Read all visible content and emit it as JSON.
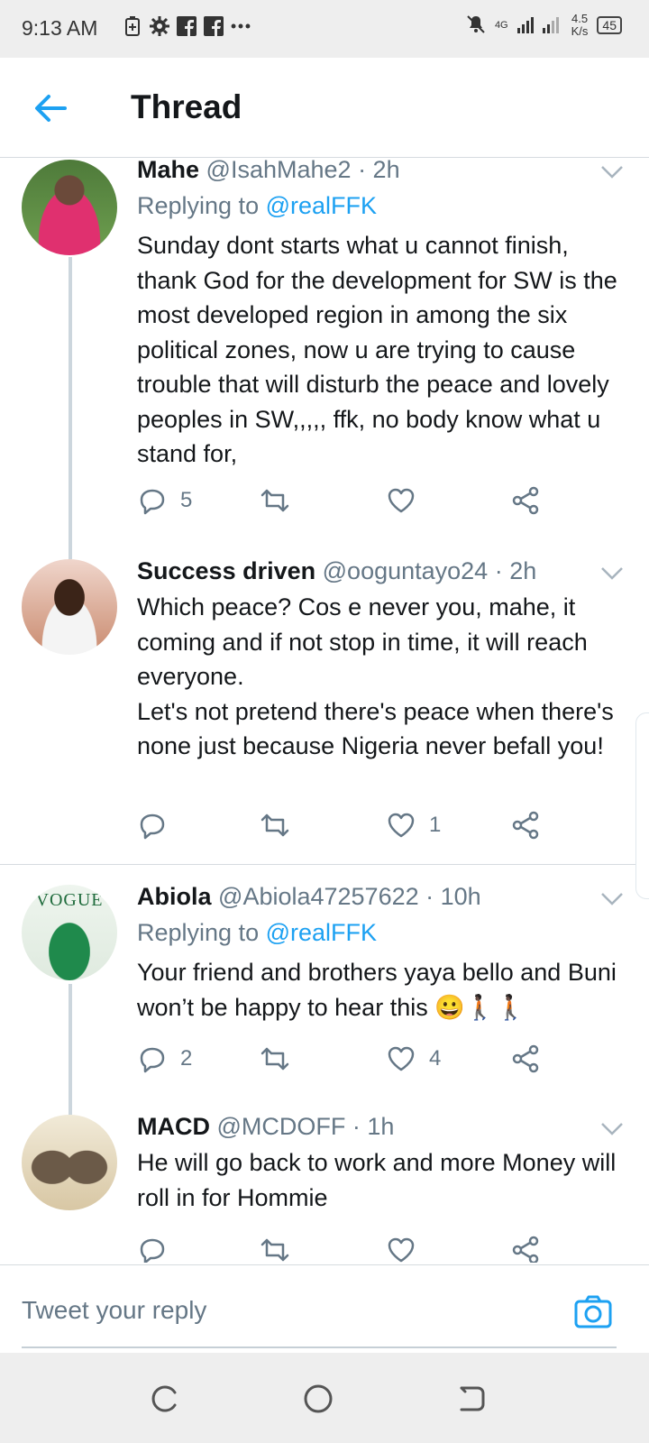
{
  "status_bar": {
    "time": "9:13 AM",
    "network": "4G",
    "speed": "4.5\nK/s",
    "battery": "45"
  },
  "app_bar": {
    "title": "Thread"
  },
  "tweets": [
    {
      "name": "Mahe",
      "handle": "@IsahMahe2",
      "time": "· 2h",
      "replying_prefix": "Replying to ",
      "replying_to": "@realFFK",
      "text": "Sunday dont starts what u cannot finish, thank God for the development for SW is the most developed region in among the six political zones, now u are trying to cause trouble that will disturb the peace and lovely peoples in SW,,,,, ffk, no body know what u stand for,",
      "reply_count": "5",
      "retweet_count": "",
      "like_count": ""
    },
    {
      "name": "Success driven",
      "handle": "@ooguntayo24",
      "time": "· 2h",
      "text": "Which peace? Cos e never you, mahe, it coming and if not stop in time, it will reach everyone.\nLet's not pretend there's peace when there's none just because Nigeria never befall you!",
      "reply_count": "",
      "retweet_count": "",
      "like_count": "1"
    },
    {
      "name": "Abiola",
      "handle": "@Abiola47257622",
      "time": "· 10h",
      "replying_prefix": "Replying to ",
      "replying_to": "@realFFK",
      "text": "Your friend and brothers yaya bello and Buni won’t be happy to hear this 😀🚶🏿🚶🏿",
      "avatar_text": "VOGUE",
      "reply_count": "2",
      "retweet_count": "",
      "like_count": "4"
    },
    {
      "name": "MACD",
      "handle": "@MCDOFF",
      "time": "· 1h",
      "text": "He will go back to work and more Money will roll in for Hommie"
    }
  ],
  "reply_bar": {
    "placeholder": "Tweet your reply"
  },
  "colors": {
    "accent": "#1da1f2",
    "muted": "#657786",
    "text": "#14171a"
  },
  "icons": [
    "back-arrow-icon",
    "chevron-down-icon",
    "reply-icon",
    "retweet-icon",
    "like-icon",
    "share-icon",
    "camera-icon"
  ]
}
